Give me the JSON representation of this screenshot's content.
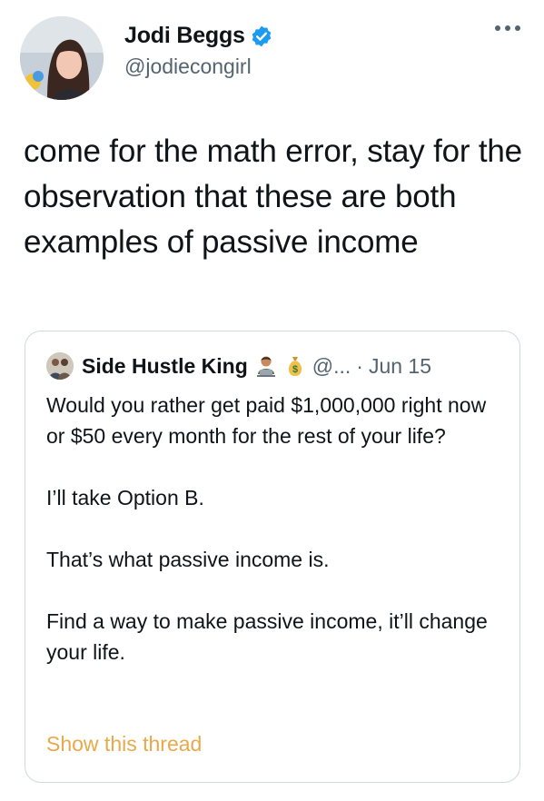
{
  "author": {
    "display_name": "Jodi Beggs",
    "handle": "@jodiecongirl",
    "verified": true
  },
  "tweet_text": "come for the math error, stay for the observation that these are both examples of passive income",
  "quoted_tweet": {
    "author_name": "Side Hustle King",
    "author_emojis": [
      "technologist-emoji",
      "money-bag-emoji"
    ],
    "handle": "@...",
    "separator": "·",
    "date": "Jun 15",
    "paragraphs": [
      "Would you rather get paid $1,000,000 right now or $50 every month for the rest of your life?",
      "I’ll take Option B.",
      "That’s what passive income is.",
      "Find a way to make passive income, it’ll change your life."
    ],
    "show_thread_label": "Show this thread"
  },
  "colors": {
    "verified_blue": "#1d9bf0",
    "secondary_text": "#536471",
    "link_orange": "#e8a94a",
    "border": "#cfd9de"
  }
}
